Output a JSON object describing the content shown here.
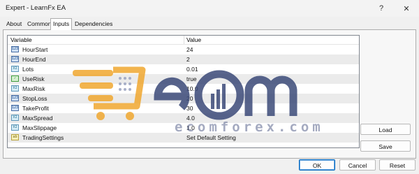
{
  "window": {
    "title": "Expert - LearnFx EA",
    "help_glyph": "?",
    "close_glyph": "✕"
  },
  "tabs": [
    {
      "label": "About"
    },
    {
      "label": "Common"
    },
    {
      "label": "Inputs",
      "active": true
    },
    {
      "label": "Dependencies"
    }
  ],
  "grid": {
    "header_variable": "Variable",
    "header_value": "Value",
    "rows": [
      {
        "icon": "int-icon",
        "badge": "123",
        "name": "HourStart",
        "value": "24"
      },
      {
        "icon": "int-icon",
        "badge": "123",
        "name": "HourEnd",
        "value": "2"
      },
      {
        "icon": "double-icon",
        "badge": "V2",
        "name": "Lots",
        "value": "0.01"
      },
      {
        "icon": "bool-icon",
        "badge": "✓",
        "name": "UseRisk",
        "value": "true"
      },
      {
        "icon": "double-icon",
        "badge": "V2",
        "name": "MaxRisk",
        "value": "10.0"
      },
      {
        "icon": "int-icon",
        "badge": "123",
        "name": "StopLoss",
        "value": "20"
      },
      {
        "icon": "int-icon",
        "badge": "123",
        "name": "TakeProfit",
        "value": "30"
      },
      {
        "icon": "double-icon",
        "badge": "V2",
        "name": "MaxSpread",
        "value": "4.0"
      },
      {
        "icon": "double-icon",
        "badge": "V2",
        "name": "MaxSlippage",
        "value": "1.0"
      },
      {
        "icon": "string-icon",
        "badge": "ab",
        "name": "TradingSettings",
        "value": "Set Default Setting"
      }
    ]
  },
  "watermark": {
    "text": "ecomforex.com"
  },
  "buttons": {
    "load": "Load",
    "save": "Save",
    "ok": "OK",
    "cancel": "Cancel",
    "reset": "Reset"
  },
  "colors": {
    "accent": "#0067c0",
    "watermark_orange": "#f0a830",
    "watermark_navy": "#3b4a78"
  }
}
